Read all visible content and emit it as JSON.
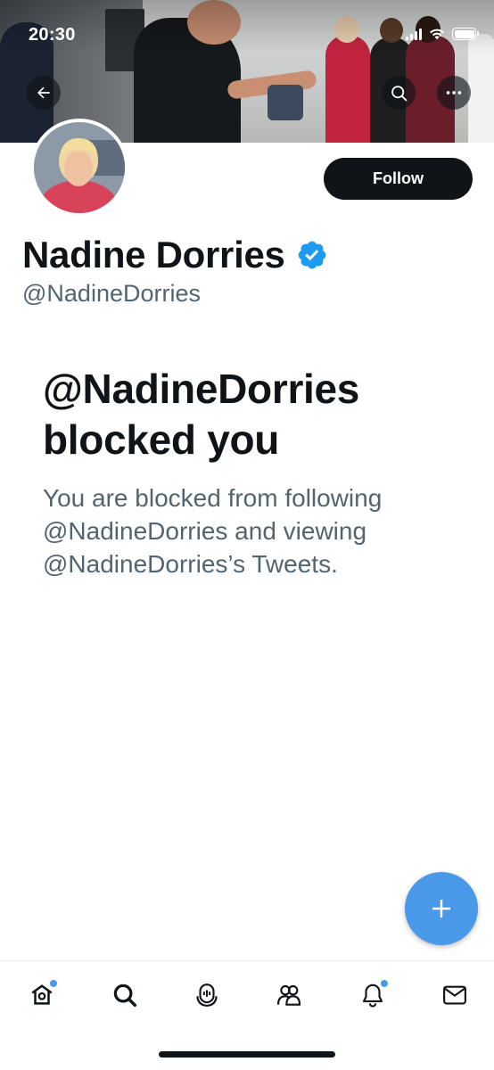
{
  "status_bar": {
    "time": "20:30"
  },
  "header": {
    "back_icon": "arrow-left-icon",
    "search_icon": "search-icon",
    "more_icon": "more-horizontal-icon"
  },
  "profile": {
    "display_name": "Nadine Dorries",
    "handle": "@NadineDorries",
    "verified": true,
    "follow_label": "Follow"
  },
  "blocked": {
    "title": "@NadineDorries blocked you",
    "description": "You are blocked from following @NadineDorries and viewing @NadineDorries’s Tweets."
  },
  "fab": {
    "icon": "plus-icon"
  },
  "tabbar": {
    "items": [
      {
        "icon": "home-icon",
        "has_dot": true
      },
      {
        "icon": "search-icon",
        "has_dot": false
      },
      {
        "icon": "spaces-icon",
        "has_dot": false
      },
      {
        "icon": "communities-icon",
        "has_dot": false
      },
      {
        "icon": "notifications-icon",
        "has_dot": true
      },
      {
        "icon": "messages-icon",
        "has_dot": false
      }
    ]
  },
  "colors": {
    "accent": "#4a99e9",
    "text_primary": "#0f1419",
    "text_secondary": "#536471",
    "verified": "#1d9bf0"
  }
}
